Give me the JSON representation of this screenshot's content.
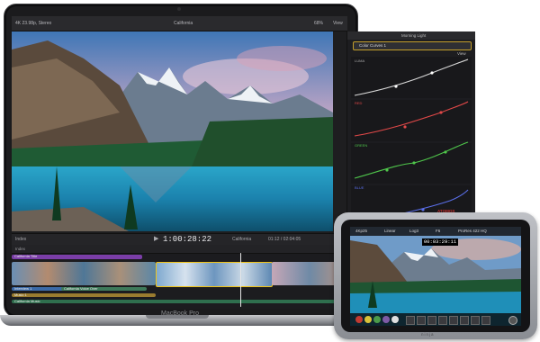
{
  "device": {
    "label": "MacBook Pro"
  },
  "fcp": {
    "toolbar": {
      "library": "4K 23.98p, Stereo",
      "clip_title": "California",
      "zoom": "68%",
      "view": "View",
      "inspector_title": "Morning Light"
    },
    "viewer": {
      "play_icon": "play-icon",
      "timecode": "1:00:28:22",
      "index_label": "Index",
      "timeline_name": "California",
      "duration": "01:12 / 02:04:05"
    },
    "color_inspector": {
      "effect_name": "Color Curves 1",
      "view": "View",
      "curves": [
        {
          "name": "LUMA",
          "color": "#d9d9d9"
        },
        {
          "name": "RED",
          "color": "#e04848"
        },
        {
          "name": "GREEN",
          "color": "#4fc64b"
        },
        {
          "name": "BLUE",
          "color": "#5a6ee8"
        }
      ]
    },
    "timeline": {
      "header_left": "Index",
      "clip_labels": [
        "California Title",
        "Interview 1",
        "California Voice Over",
        "Music 1",
        "California Music"
      ]
    }
  },
  "monitor": {
    "brand": "ATOMOS",
    "top": [
      "4Kp25",
      "Linear",
      "Log3",
      "F6",
      "ProRes 422 HQ"
    ],
    "timecode": "00:03:29:11",
    "logo": "ninja",
    "color_dots": [
      "#c23b32",
      "#d9c23a",
      "#4b9b4a",
      "#7e5aa6",
      "#e0e0e0"
    ]
  }
}
